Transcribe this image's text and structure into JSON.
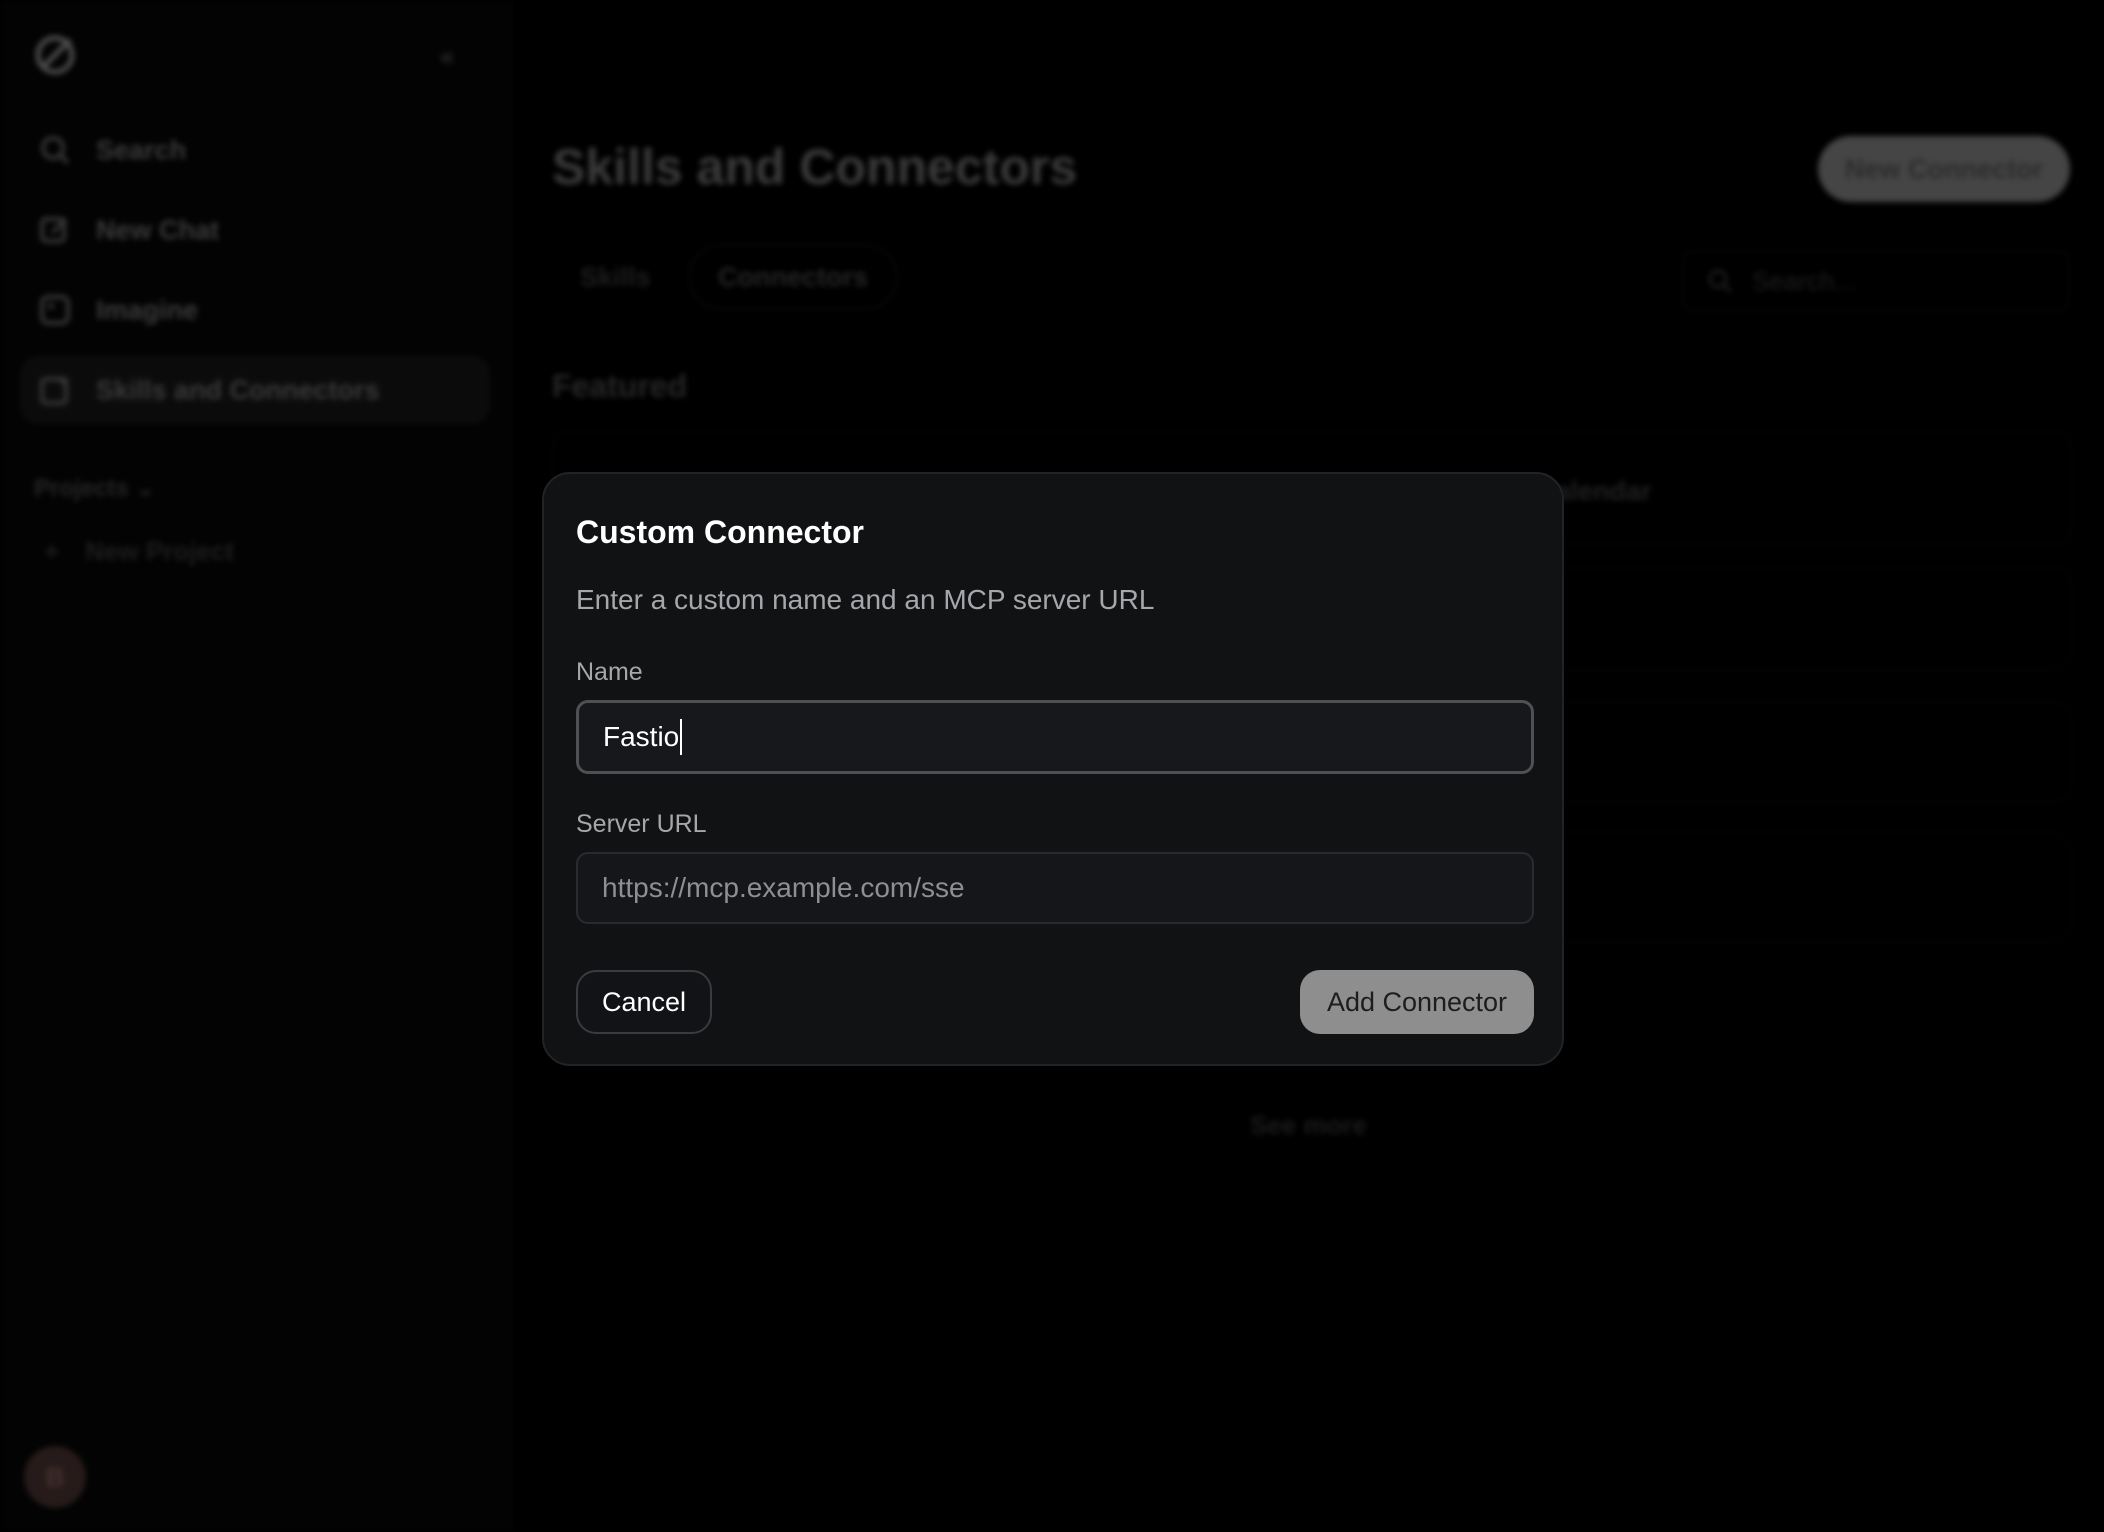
{
  "sidebar": {
    "items": [
      {
        "label": "Search",
        "icon": "search-icon"
      },
      {
        "label": "New Chat",
        "icon": "edit-icon"
      },
      {
        "label": "Imagine",
        "icon": "image-icon"
      },
      {
        "label": "Skills and Connectors",
        "icon": "puzzle-icon",
        "active": true
      }
    ],
    "projects_label": "Projects",
    "new_project_label": "New Project",
    "avatar_initial": "B"
  },
  "main": {
    "title": "Skills and Connectors",
    "new_connector_label": "New Connector",
    "tabs": [
      {
        "label": "Skills"
      },
      {
        "label": "Connectors",
        "active": true
      }
    ],
    "search_placeholder": "Search...",
    "featured_label": "Featured",
    "card_label": "Calendar",
    "see_more_label": "See more"
  },
  "modal": {
    "title": "Custom Connector",
    "description": "Enter a custom name and an MCP server URL",
    "name_label": "Name",
    "name_value": "Fastio",
    "url_label": "Server URL",
    "url_placeholder": "https://mcp.example.com/sse",
    "cancel_label": "Cancel",
    "add_label": "Add Connector"
  },
  "colors": {
    "modal_bg": "#111214",
    "add_button_bg": "#8e8e8e",
    "text_primary": "#ffffff",
    "text_secondary": "#a6a7aa"
  }
}
